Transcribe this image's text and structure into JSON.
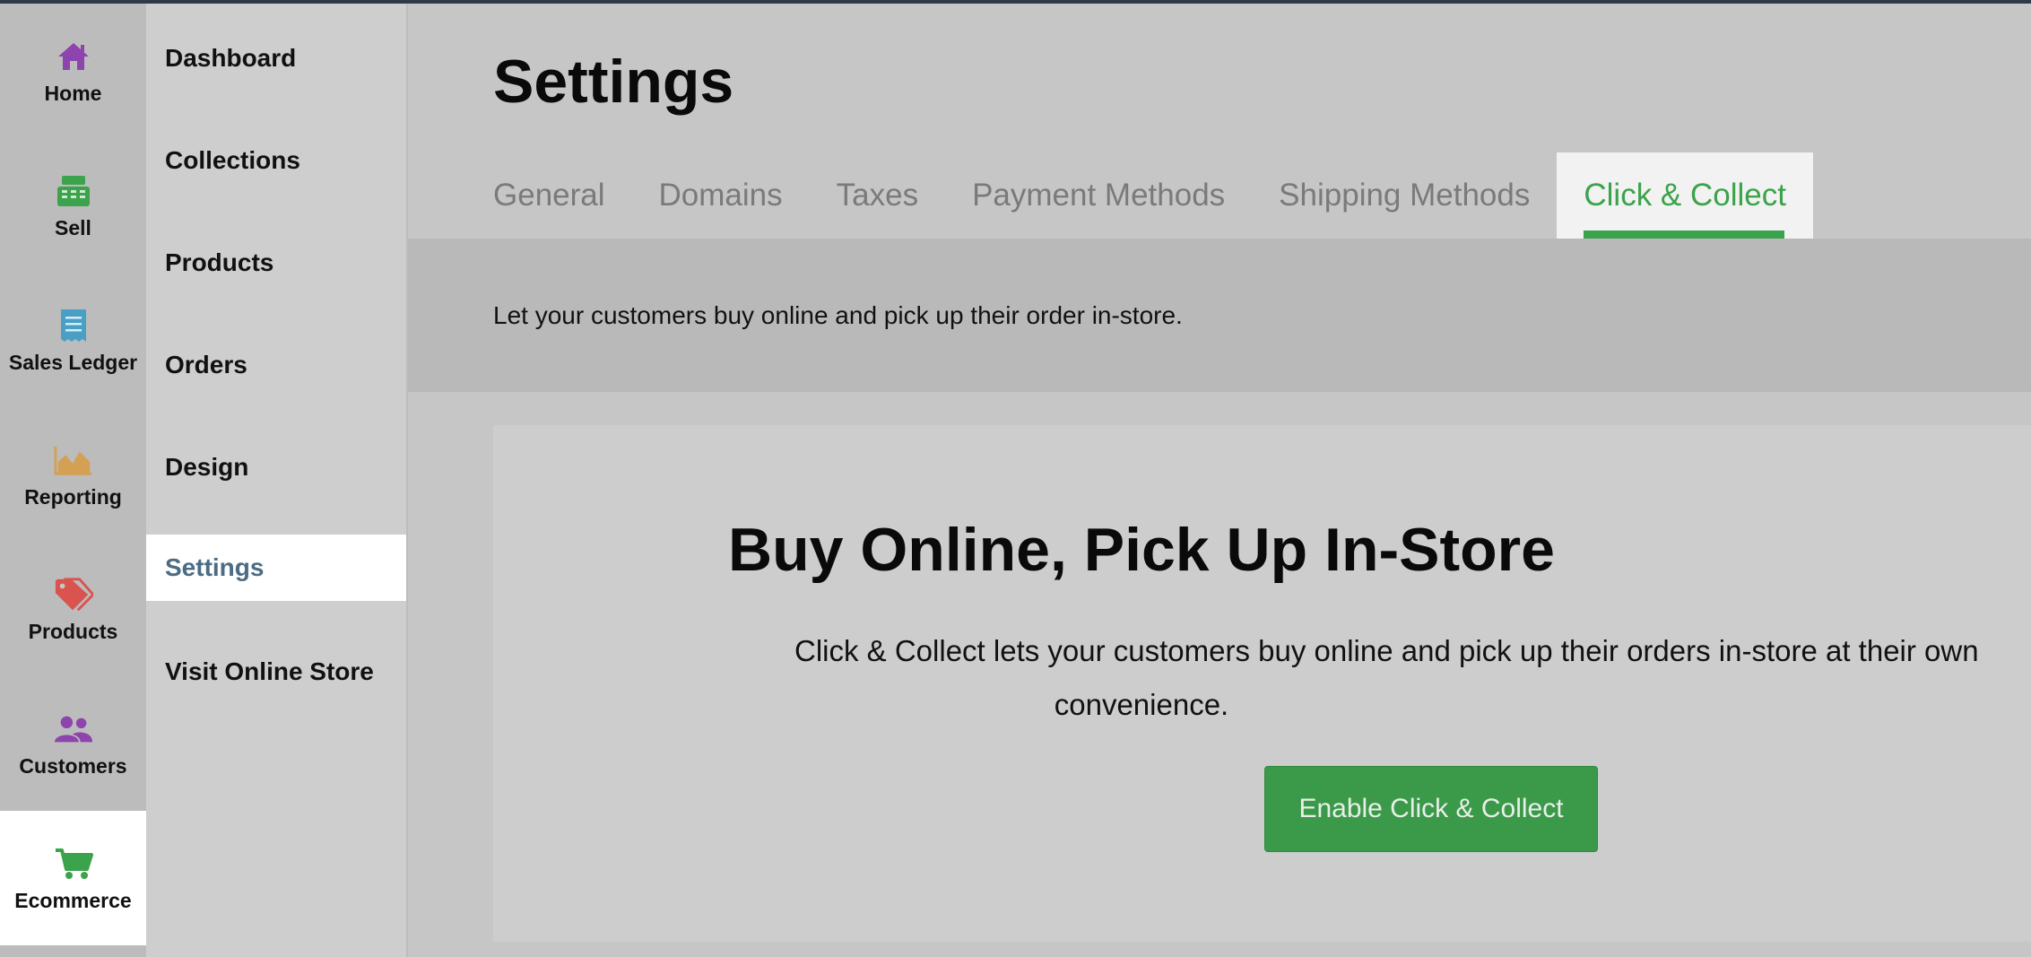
{
  "rail": {
    "items": [
      {
        "label": "Home",
        "icon": "home-icon",
        "color": "#8e44ad"
      },
      {
        "label": "Sell",
        "icon": "register-icon",
        "color": "#3ba34b"
      },
      {
        "label": "Sales Ledger",
        "icon": "receipt-icon",
        "color": "#4a9fc4"
      },
      {
        "label": "Reporting",
        "icon": "area-chart-icon",
        "color": "#d4a053"
      },
      {
        "label": "Products",
        "icon": "tag-icon",
        "color": "#d9534f"
      },
      {
        "label": "Customers",
        "icon": "users-icon",
        "color": "#8e44ad"
      },
      {
        "label": "Ecommerce",
        "icon": "cart-icon",
        "color": "#3ba34b"
      }
    ],
    "active": "Ecommerce"
  },
  "subnav": {
    "items": [
      {
        "label": "Dashboard"
      },
      {
        "label": "Collections"
      },
      {
        "label": "Products"
      },
      {
        "label": "Orders"
      },
      {
        "label": "Design"
      },
      {
        "label": "Settings"
      },
      {
        "label": "Visit Online Store"
      }
    ],
    "active": "Settings"
  },
  "page": {
    "title": "Settings",
    "tabs": [
      {
        "label": "General"
      },
      {
        "label": "Domains"
      },
      {
        "label": "Taxes"
      },
      {
        "label": "Payment Methods"
      },
      {
        "label": "Shipping Methods"
      },
      {
        "label": "Click & Collect"
      }
    ],
    "active_tab": "Click & Collect",
    "info": "Let your customers buy online and pick up their order in-store."
  },
  "card": {
    "title": "Buy Online, Pick Up In-Store",
    "description_line1": "Click & Collect lets your customers buy online and pick up their orders in-store at their own",
    "description_line2": "convenience.",
    "button_label": "Enable Click & Collect"
  },
  "colors": {
    "accent": "#3ba34b",
    "active_subnav_text": "#4b6c84"
  }
}
